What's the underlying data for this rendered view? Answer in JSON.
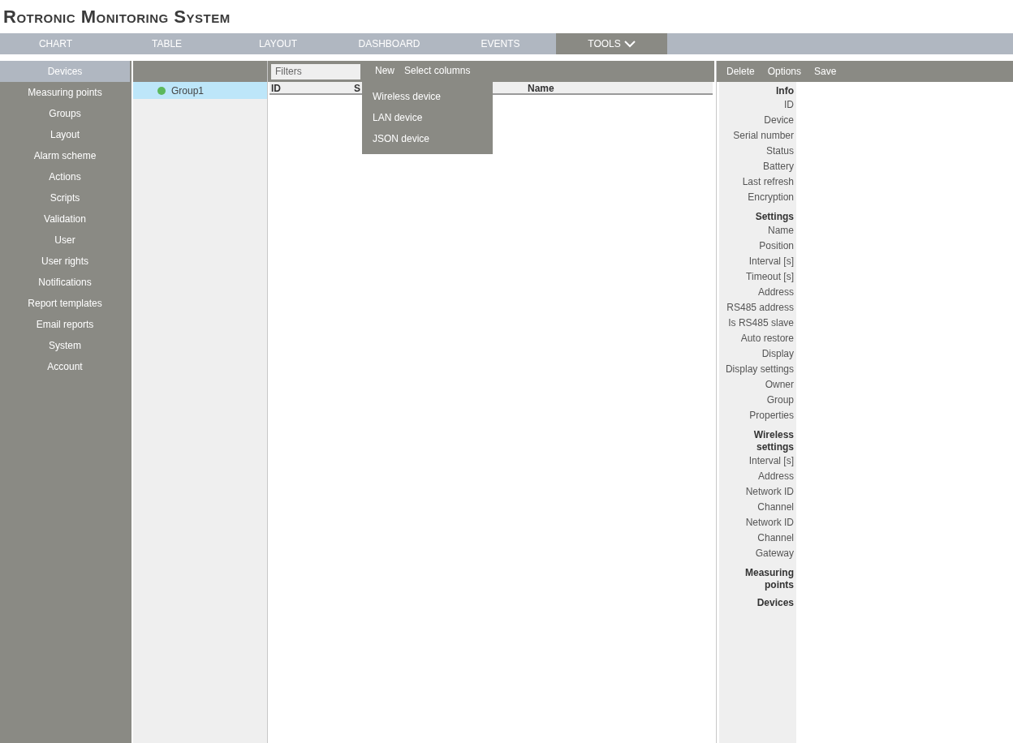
{
  "app_title": "Rotronic Monitoring System",
  "nav_tabs": [
    {
      "label": "CHART",
      "selected": false,
      "has_menu": false
    },
    {
      "label": "TABLE",
      "selected": false,
      "has_menu": false
    },
    {
      "label": "LAYOUT",
      "selected": false,
      "has_menu": false
    },
    {
      "label": "DASHBOARD",
      "selected": false,
      "has_menu": false
    },
    {
      "label": "EVENTS",
      "selected": false,
      "has_menu": false
    },
    {
      "label": "TOOLS",
      "selected": true,
      "has_menu": true
    }
  ],
  "sidebar": {
    "items": [
      {
        "label": "Devices",
        "selected": true
      },
      {
        "label": "Measuring points",
        "selected": false
      },
      {
        "label": "Groups",
        "selected": false
      },
      {
        "label": "Layout",
        "selected": false
      },
      {
        "label": "Alarm scheme",
        "selected": false
      },
      {
        "label": "Actions",
        "selected": false
      },
      {
        "label": "Scripts",
        "selected": false
      },
      {
        "label": "Validation",
        "selected": false
      },
      {
        "label": "User",
        "selected": false
      },
      {
        "label": "User rights",
        "selected": false
      },
      {
        "label": "Notifications",
        "selected": false
      },
      {
        "label": "Report templates",
        "selected": false
      },
      {
        "label": "Email reports",
        "selected": false
      },
      {
        "label": "System",
        "selected": false
      },
      {
        "label": "Account",
        "selected": false
      }
    ]
  },
  "groups": [
    {
      "label": "Group1",
      "selected": true,
      "color": "#5cb85c"
    }
  ],
  "toolbar": {
    "filter": {
      "placeholder": "Filters"
    },
    "buttons": [
      "New",
      "Select columns"
    ]
  },
  "new_menu": {
    "items": [
      "Wireless device",
      "LAN device",
      "JSON device"
    ]
  },
  "table": {
    "columns": [
      "ID",
      "S",
      "Name"
    ]
  },
  "details_toolbar": {
    "buttons": [
      "Delete",
      "Options",
      "Save"
    ]
  },
  "details": [
    {
      "title": "Info",
      "fields": [
        "ID",
        "Device",
        "Serial number",
        "Status",
        "Battery",
        "Last refresh",
        "Encryption"
      ]
    },
    {
      "title": "Settings",
      "fields": [
        "Name",
        "Position",
        "Interval [s]",
        "Timeout [s]",
        "Address",
        "RS485 address",
        "Is RS485 slave",
        "Auto restore",
        "Display",
        "Display settings",
        "Owner",
        "Group",
        "Properties"
      ]
    },
    {
      "title": "Wireless settings",
      "fields": [
        "Interval [s]",
        "Address",
        "Network ID",
        "Channel",
        "Network ID",
        "Channel",
        "Gateway"
      ]
    },
    {
      "title": "Measuring points"
    },
    {
      "title": "Devices"
    }
  ]
}
